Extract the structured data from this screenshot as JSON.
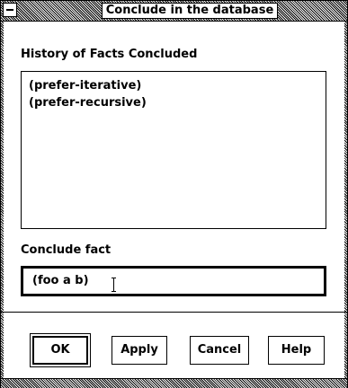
{
  "window": {
    "title": "Conclude in the database"
  },
  "history": {
    "label": "History of Facts Concluded",
    "items": [
      "(prefer-iterative)",
      "(prefer-recursive)"
    ]
  },
  "conclude": {
    "label": "Conclude fact",
    "value": "(foo a b)"
  },
  "buttons": {
    "ok": "OK",
    "apply": "Apply",
    "cancel": "Cancel",
    "help": "Help"
  }
}
